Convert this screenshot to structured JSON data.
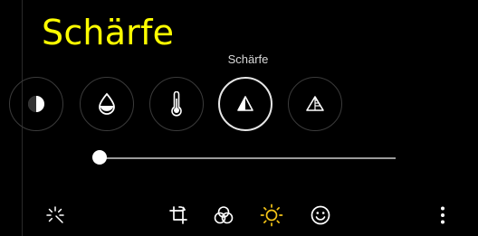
{
  "title": "Schärfe",
  "tool_caption": "Schärfe",
  "tools": [
    {
      "name": "contrast-icon",
      "selected": false
    },
    {
      "name": "saturation-icon",
      "selected": false
    },
    {
      "name": "temperature-icon",
      "selected": false
    },
    {
      "name": "sharpness-icon",
      "selected": true
    },
    {
      "name": "definition-icon",
      "selected": false
    }
  ],
  "slider": {
    "value_fraction": 0.0
  },
  "bottom_bar": [
    {
      "name": "auto-enhance-icon"
    },
    {
      "name": "crop-rotate-icon"
    },
    {
      "name": "filters-icon"
    },
    {
      "name": "adjust-brightness-icon",
      "active": true
    },
    {
      "name": "stickers-icon"
    },
    {
      "name": "more-options-icon"
    }
  ],
  "colors": {
    "title": "#FFFF00",
    "active_icon": "#F5C518",
    "background": "#000000"
  }
}
